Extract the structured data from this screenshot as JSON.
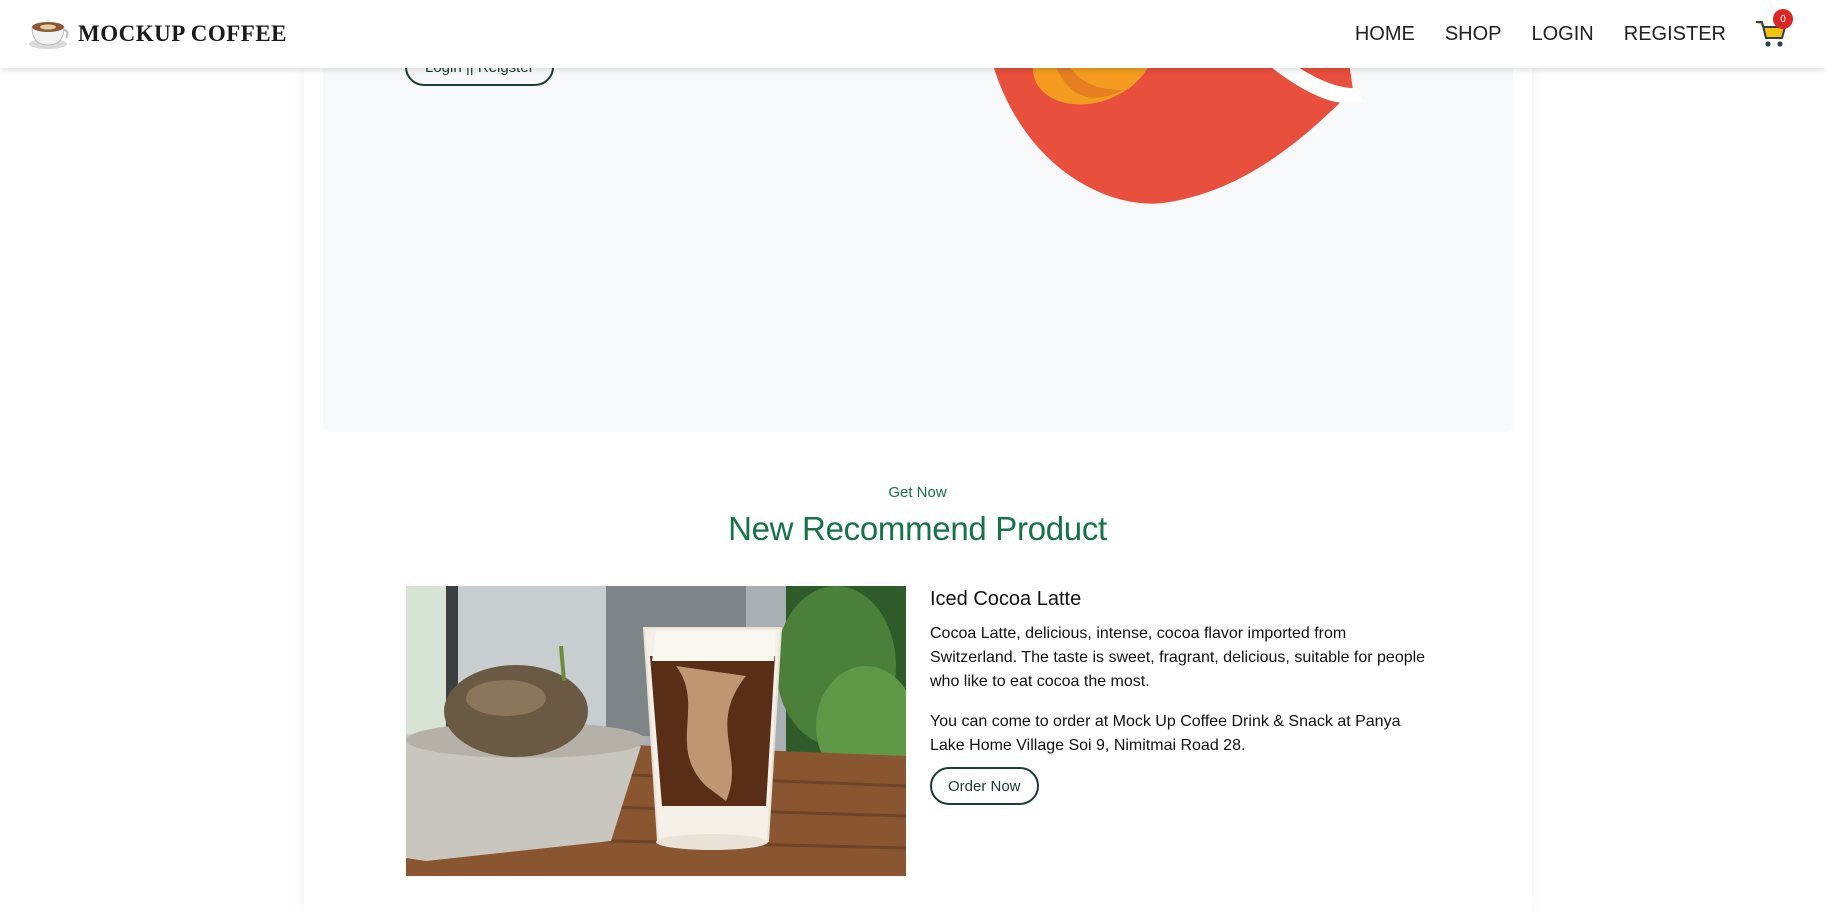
{
  "brand": {
    "name": "MOCKUP COFFEE",
    "icon": "coffee-cup-icon"
  },
  "nav": {
    "items": [
      {
        "label": "HOME"
      },
      {
        "label": "SHOP"
      },
      {
        "label": "LOGIN"
      },
      {
        "label": "REGISTER"
      }
    ],
    "cart": {
      "icon": "shopping-cart-icon",
      "count": "0"
    }
  },
  "hero": {
    "button_label": "Login || Reigster"
  },
  "recommend": {
    "eyebrow": "Get Now",
    "title": "New Recommend Product",
    "product": {
      "name": "Iced Cocoa Latte",
      "description": "Cocoa Latte, delicious, intense, cocoa flavor imported from Switzerland. The taste is sweet, fragrant, delicious, suitable for people who like to eat cocoa the most.",
      "location": "You can come to order at Mock Up Coffee Drink & Snack at Panya Lake Home Village Soi 9, Nimitmai Road 28.",
      "order_label": "Order Now"
    }
  },
  "colors": {
    "accent_green": "#157347",
    "button_border": "#1b3b36",
    "badge_red": "#dc2626",
    "hero_bg": "#f8f9fa",
    "bag_red": "#e84f3c",
    "bag_orange": "#f39c1f"
  }
}
